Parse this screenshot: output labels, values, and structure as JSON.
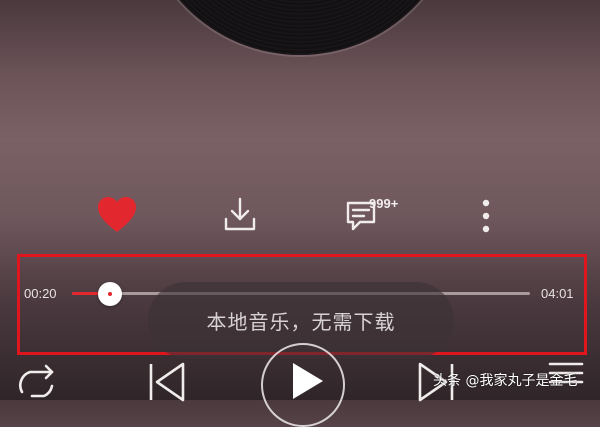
{
  "player": {
    "comments": {
      "badge": "999+"
    },
    "progress": {
      "current_time": "00:20",
      "total_time": "04:01",
      "fraction": 0.083
    },
    "toast": "本地音乐，无需下载",
    "colors": {
      "accent": "#e3272f",
      "highlight_border": "#e0161f",
      "icon": "#f0ecec"
    }
  },
  "icons": {
    "like": "heart-icon",
    "download": "download-icon",
    "comments": "comment-icon",
    "more": "more-vertical-icon",
    "repeat": "repeat-icon",
    "previous": "skip-previous-icon",
    "play": "play-icon",
    "next": "skip-next-icon",
    "playlist": "playlist-icon"
  },
  "watermark": "头条 @我家丸子是金毛"
}
